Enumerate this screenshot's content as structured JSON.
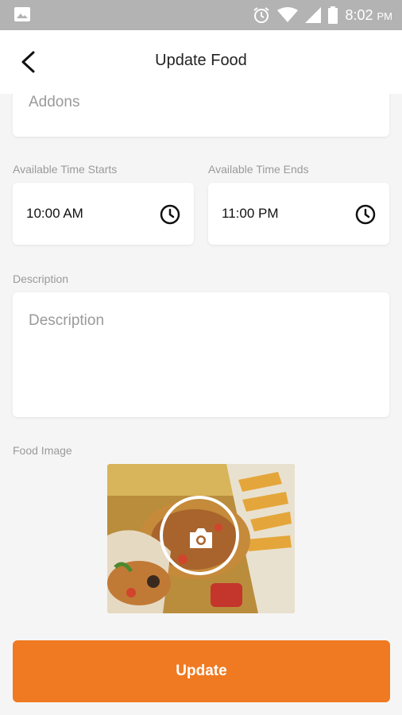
{
  "status_bar": {
    "time": "8:02",
    "ampm": "PM",
    "icons": [
      "image-icon",
      "alarm-icon",
      "wifi-icon",
      "signal-icon",
      "battery-icon"
    ]
  },
  "app_bar": {
    "title": "Update Food",
    "back_icon": "back-arrow-icon"
  },
  "form": {
    "addons": {
      "placeholder": "Addons"
    },
    "time_start": {
      "label": "Available Time Starts",
      "value": "10:00 AM",
      "icon": "clock-icon"
    },
    "time_end": {
      "label": "Available Time Ends",
      "value": "11:00 PM",
      "icon": "clock-icon"
    },
    "description": {
      "label": "Description",
      "placeholder": "Description"
    },
    "food_image": {
      "label": "Food Image",
      "icon": "camera-icon"
    }
  },
  "actions": {
    "update_label": "Update"
  },
  "colors": {
    "accent": "#ef7a22",
    "status_bar": "#b3b3b3",
    "background": "#f5f5f5"
  }
}
